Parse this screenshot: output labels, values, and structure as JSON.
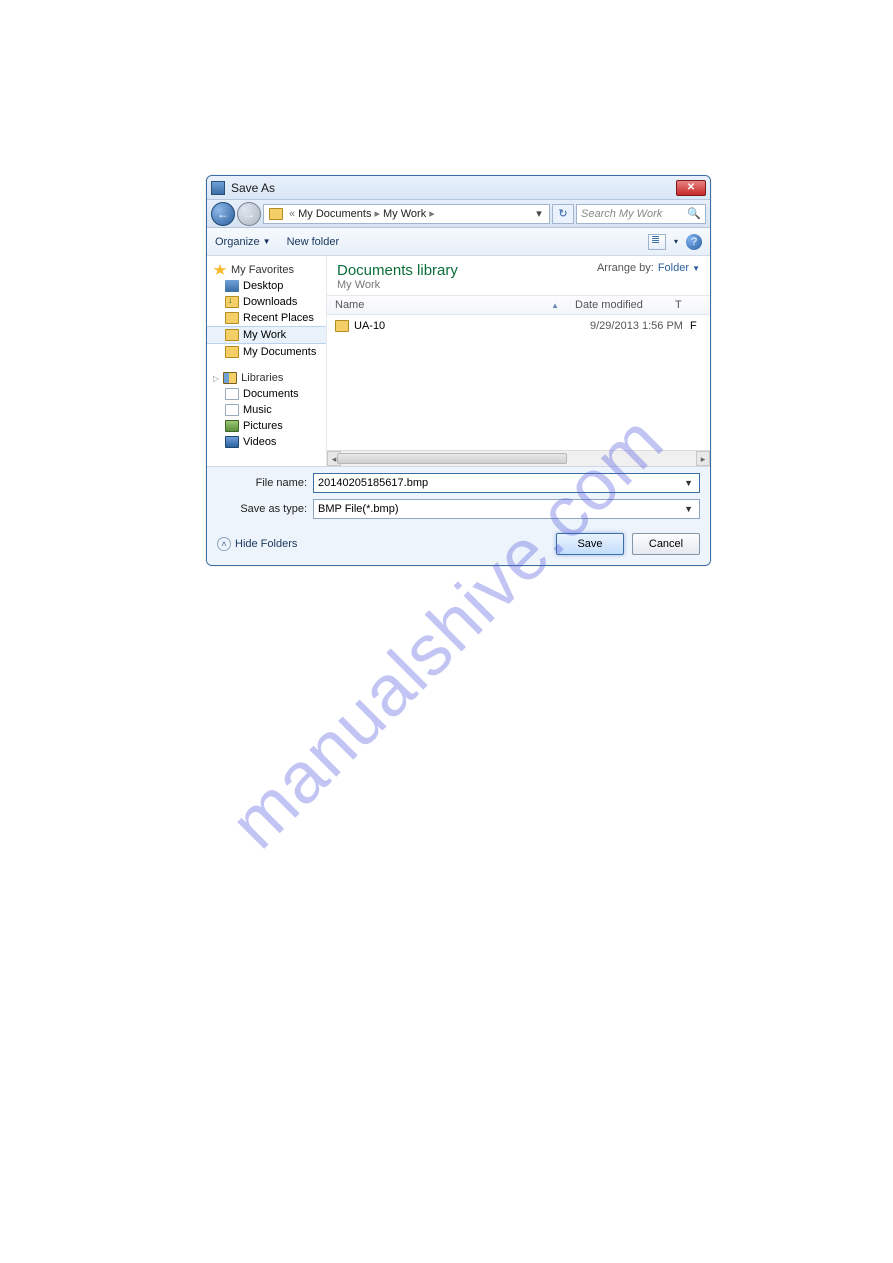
{
  "watermark": "manualshive.com",
  "title": "Save As",
  "breadcrumb": {
    "root_marker": "«",
    "parts": [
      "My Documents",
      "My Work"
    ],
    "dropdown_glyph": "▾"
  },
  "refresh_glyph": "↻",
  "search": {
    "placeholder": "Search My Work",
    "mag_glyph": "🔍"
  },
  "toolbar": {
    "organize": "Organize",
    "new_folder": "New folder",
    "views_glyph": "▾",
    "help_glyph": "?"
  },
  "sidebar": {
    "favorites_label": "My Favorites",
    "favorites": [
      {
        "label": "Desktop",
        "ico": "desktop"
      },
      {
        "label": "Downloads",
        "ico": "dl"
      },
      {
        "label": "Recent Places",
        "ico": "recent"
      },
      {
        "label": "My Work",
        "ico": "folder",
        "selected": true
      },
      {
        "label": "My Documents",
        "ico": "folder"
      }
    ],
    "libraries_label": "Libraries",
    "libraries": [
      {
        "label": "Documents",
        "ico": "doc"
      },
      {
        "label": "Music",
        "ico": "music"
      },
      {
        "label": "Pictures",
        "ico": "pic"
      },
      {
        "label": "Videos",
        "ico": "vid"
      }
    ]
  },
  "content": {
    "library_title": "Documents library",
    "library_sub": "My Work",
    "arrange_label": "Arrange by:",
    "arrange_value": "Folder",
    "columns": {
      "name": "Name",
      "date": "Date modified",
      "type_initial": "T"
    },
    "rows": [
      {
        "name": "UA-10",
        "date": "9/29/2013 1:56 PM",
        "tail": "F"
      }
    ]
  },
  "fields": {
    "filename_label": "File name:",
    "filename_value": "20140205185617.bmp",
    "savetype_label": "Save as type:",
    "savetype_value": "BMP File(*.bmp)"
  },
  "footer": {
    "hide_folders": "Hide Folders",
    "save": "Save",
    "cancel": "Cancel"
  }
}
